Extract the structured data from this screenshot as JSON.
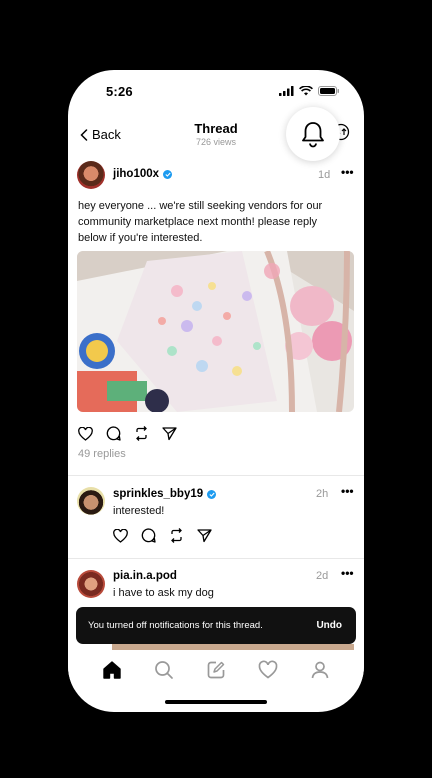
{
  "status_bar": {
    "time": "5:26"
  },
  "nav": {
    "back_label": "Back",
    "title": "Thread",
    "views": "726 views"
  },
  "post": {
    "username": "jiho100x",
    "time": "1d",
    "text": "hey everyone ... we're still seeking vendors for our community marketplace next month! please reply below if you're interested.",
    "replies": "49 replies"
  },
  "replies": [
    {
      "username": "sprinkles_bby19",
      "time": "2h",
      "text": "interested!",
      "verified": true
    },
    {
      "username": "pia.in.a.pod",
      "time": "2d",
      "text": "i have to ask my dog",
      "verified": false
    }
  ],
  "toast": {
    "message": "You turned off notifications for this thread.",
    "action": "Undo"
  },
  "icons": {
    "bell": "bell-icon",
    "tabs": [
      "home-icon",
      "search-icon",
      "compose-icon",
      "heart-icon",
      "profile-icon"
    ]
  },
  "colors": {
    "verified": "#1d9bf0",
    "toast_bg": "#111111"
  }
}
